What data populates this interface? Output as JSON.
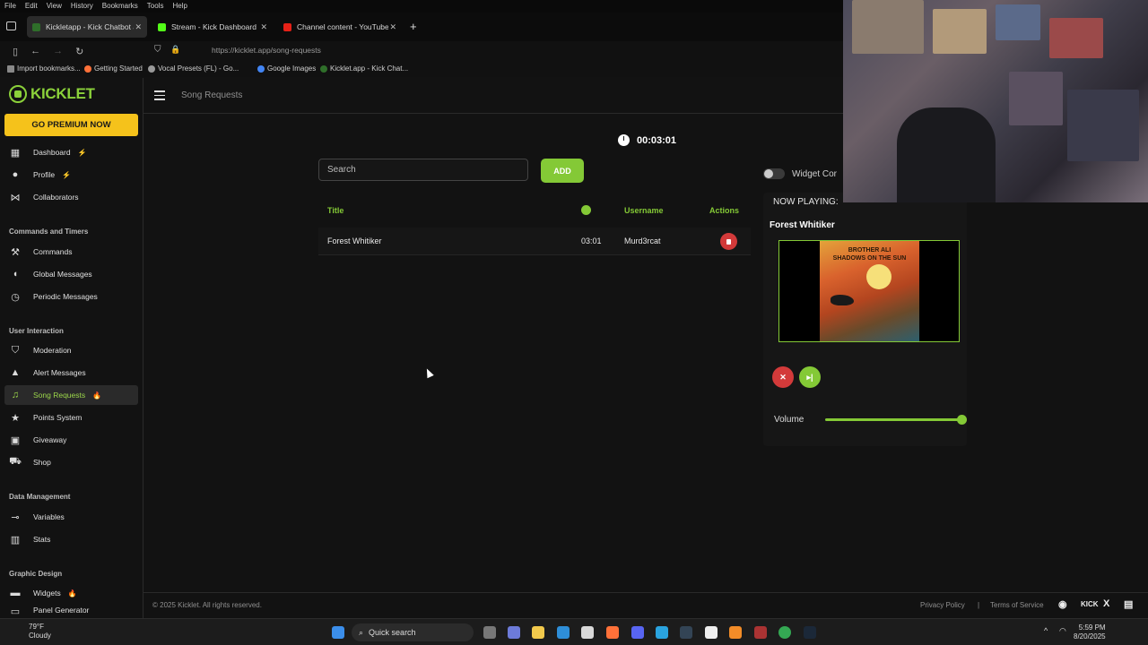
{
  "browser": {
    "menu": [
      "File",
      "Edit",
      "View",
      "History",
      "Bookmarks",
      "Tools",
      "Help"
    ],
    "tabs": [
      {
        "label": "Kickletapp - Kick Chatbot a",
        "active": true
      },
      {
        "label": "Stream - Kick Dashboard",
        "active": false
      },
      {
        "label": "Channel content - YouTube Stu",
        "active": false
      }
    ],
    "url": "https://kicklet.app/song-requests",
    "bookmarks": [
      "Import bookmarks...",
      "Getting Started",
      "Vocal Presets (FL) - Go...",
      "Google Images",
      "Kicklet.app - Kick Chat..."
    ]
  },
  "sidebar": {
    "logo": "KICKLET",
    "premium_label": "GO PREMIUM NOW",
    "items_top": [
      {
        "label": "Dashboard",
        "badge": "⚡"
      },
      {
        "label": "Profile",
        "badge": "⚡"
      },
      {
        "label": "Collaborators",
        "badge": ""
      }
    ],
    "section_commands": "Commands and Timers",
    "items_commands": [
      {
        "label": "Commands"
      },
      {
        "label": "Global Messages"
      },
      {
        "label": "Periodic Messages"
      }
    ],
    "section_interaction": "User Interaction",
    "items_interaction": [
      {
        "label": "Moderation",
        "badge": ""
      },
      {
        "label": "Alert Messages",
        "badge": ""
      },
      {
        "label": "Song Requests",
        "badge": "🔥"
      },
      {
        "label": "Points System",
        "badge": ""
      },
      {
        "label": "Giveaway",
        "badge": ""
      },
      {
        "label": "Shop",
        "badge": ""
      }
    ],
    "section_data": "Data Management",
    "items_data": [
      {
        "label": "Variables"
      },
      {
        "label": "Stats"
      }
    ],
    "section_graphic": "Graphic Design",
    "items_graphic": [
      {
        "label": "Widgets",
        "badge": "🔥"
      },
      {
        "label": "Panel Generator",
        "badge": ""
      }
    ]
  },
  "header": {
    "page_title": "Song Requests"
  },
  "main": {
    "timer": "00:03:01",
    "search_placeholder": "Search",
    "add_label": "ADD",
    "columns": {
      "title": "Title",
      "username": "Username",
      "actions": "Actions"
    },
    "rows": [
      {
        "title": "Forest Whitiker",
        "duration": "03:01",
        "username": "Murd3rcat"
      }
    ]
  },
  "widget": {
    "toggle_label": "Widget Cor",
    "now_playing_label": "NOW PLAYING:",
    "track_title": "Forest Whitiker",
    "album_text": "BROTHER ALI\nSHADOWS ON THE SUN",
    "volume_label": "Volume",
    "volume_level": 1.0
  },
  "footer": {
    "copyright": "© 2025 Kicklet. All rights reserved.",
    "privacy": "Privacy Policy",
    "separator": "|",
    "terms": "Terms of Service",
    "social": [
      "discord-icon",
      "kick-icon",
      "x-icon",
      "docs-icon"
    ],
    "kick_label": "KICK",
    "x_label": "X"
  },
  "taskbar": {
    "temp": "79°F",
    "weather": "Cloudy",
    "search_label": "Quick search",
    "time": "5:59 PM",
    "date": "8/20/2025"
  },
  "colors": {
    "accent": "#84c936",
    "danger": "#d33a3a",
    "premium": "#f5c21b",
    "bg": "#121212"
  }
}
